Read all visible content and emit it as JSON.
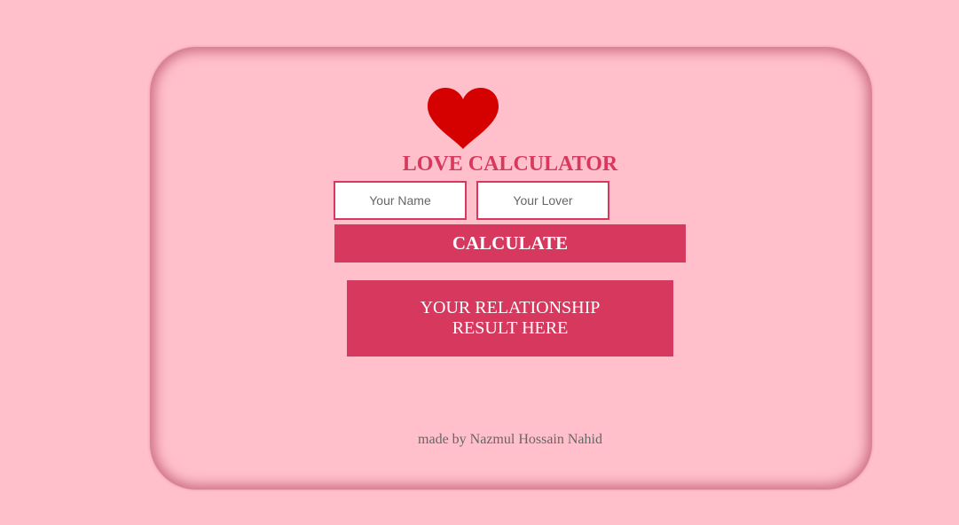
{
  "app": {
    "title": "LOVE CALCULATOR",
    "heart_icon": "heart-icon",
    "accent_color": "#d7385e",
    "heart_color": "#d50000",
    "background_color": "#ffc0cb"
  },
  "form": {
    "name_placeholder": "Your Name",
    "name_value": "",
    "lover_placeholder": "Your Lover",
    "lover_value": "",
    "calculate_label": "CALCULATE"
  },
  "result": {
    "line1": "YOUR RELATIONSHIP",
    "line2": "RESULT HERE"
  },
  "footer": {
    "credit": "made by Nazmul Hossain Nahid"
  }
}
